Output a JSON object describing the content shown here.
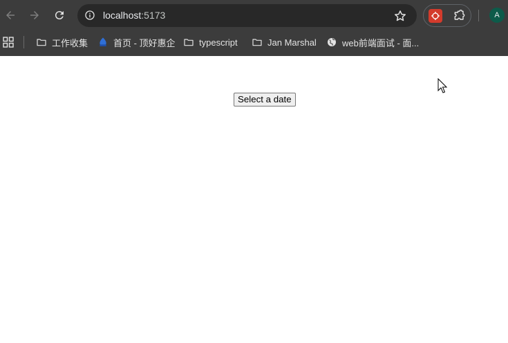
{
  "browser": {
    "url_host": "localhost",
    "url_port": ":5173",
    "avatar_letter": "A",
    "icons": {
      "back": "arrow-left-icon",
      "forward": "arrow-right-icon",
      "reload": "reload-icon",
      "site_info": "info-icon",
      "star": "star-icon",
      "extension": "extension-app-icon",
      "puzzle": "puzzle-icon",
      "apps": "apps-grid-icon"
    }
  },
  "bookmarks": [
    {
      "label": "工作收集",
      "icon": "folder-icon"
    },
    {
      "label": "首页 - 顶好惠企",
      "icon": "site-favicon-icon"
    },
    {
      "label": "typescript",
      "icon": "folder-icon"
    },
    {
      "label": "Jan Marshal",
      "icon": "folder-icon"
    },
    {
      "label": "web前端面试 - 面...",
      "icon": "globe-icon"
    }
  ],
  "page": {
    "select_date_label": "Select a date"
  },
  "colors": {
    "chrome_bg": "#3c3c3c",
    "omnibox_bg": "#282828",
    "avatar_bg": "#0d5b4a",
    "extension_red": "#d33b2c"
  }
}
